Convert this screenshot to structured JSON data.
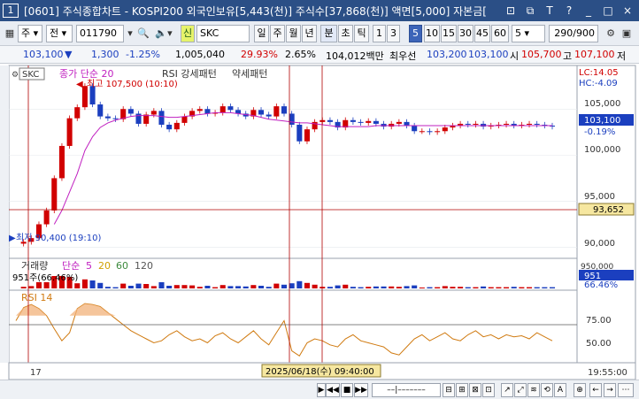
{
  "window": {
    "number": "1",
    "title": "[0601] 주식종합차트 - KOSPI200 외국인보유[5,443(천)] 주식수[37,868(천)] 액면[5,000] 자본금[",
    "buttons": [
      "⊡",
      "⧉",
      "T",
      "?",
      "_",
      "□",
      "×"
    ]
  },
  "toolbar": {
    "market": "주",
    "type": "전",
    "code": "011790",
    "name": "SKC",
    "badge": "신",
    "periods": [
      "일",
      "주",
      "월",
      "년",
      "분",
      "초",
      "틱"
    ],
    "active_period": "분",
    "intervals": [
      "1",
      "3",
      "5",
      "10",
      "15",
      "30",
      "45",
      "60"
    ],
    "active_interval": "5",
    "count": "5",
    "range": "290/900"
  },
  "quote": {
    "price": "103,100",
    "change": "1,300",
    "change_pct": "-1.25%",
    "volume": "1,005,040",
    "turnover_pct": "29.93%",
    "vol_pct": "2.65%",
    "amount": "104,012백만",
    "label_best_ask": "최우선",
    "best_ask": "103,200",
    "best_bid": "103,100",
    "label_open": "시",
    "open": "105,700",
    "label_high": "고",
    "high": "107,100",
    "label_low": "저"
  },
  "chart": {
    "legend_symbol": "SKC",
    "legend_ma": "종가 단순 20",
    "legend_rsi_pattern": "RSI 강세패턴",
    "legend_weak": "약세패턴",
    "high_label": "최고 107,500 (10:10)",
    "low_label": "최저 90,400 (19:10)",
    "lc": "LC:14.05",
    "hc": "HC:-4.09",
    "current_price": "103,100",
    "current_pct": "-0.19%",
    "crosshair_price": "93,652",
    "price_axis": [
      "105,000",
      "100,000",
      "95,000",
      "90,000"
    ],
    "volume_legend_title": "거래량",
    "volume_legend_ma": "단순",
    "volume_legend_periods": [
      "5",
      "20",
      "60",
      "120"
    ],
    "volume_value": "951주(66.46%)",
    "volume_axis_top": "950,000",
    "volume_current": "951",
    "volume_pct": "66.46%",
    "rsi_title": "RSI 14",
    "rsi_axis": [
      "75.00",
      "50.00"
    ],
    "time_start": "17",
    "time_cursor": "2025/06/18(수) 09:40:00",
    "time_end": "19:55:00"
  },
  "colors": {
    "up": "#d10000",
    "down": "#1b3fbf",
    "ma": "#c020c0",
    "rsi": "#d07a10",
    "crosshair": "#b00000"
  },
  "chart_data": {
    "type": "candlestick",
    "price_series": [
      90400,
      90600,
      91000,
      92500,
      94000,
      97500,
      101000,
      104000,
      105200,
      107500,
      105500,
      104200,
      104000,
      103900,
      105000,
      104500,
      103400,
      104400,
      104800,
      103300,
      102800,
      103500,
      104200,
      104800,
      105000,
      104500,
      104600,
      105300,
      104900,
      104500,
      104200,
      104900,
      104400,
      104200,
      105300,
      104500,
      103300,
      101500,
      102800,
      103600,
      103800,
      103600,
      103000,
      103800,
      103600,
      103500,
      103700,
      103400,
      103100,
      103400,
      103600,
      103200,
      102600,
      102600,
      102500,
      102600,
      103000,
      103200,
      103400,
      103300,
      103400,
      103100,
      103200,
      103300,
      103400,
      103200,
      103300,
      103400,
      103300,
      103200,
      103100
    ],
    "ma20_series": [
      null,
      null,
      null,
      null,
      null,
      92500,
      94000,
      96000,
      98000,
      100500,
      102000,
      103000,
      103500,
      103800,
      104000,
      104200,
      104300,
      104300,
      104300,
      104200,
      104100,
      104100,
      104200,
      104300,
      104400,
      104500,
      104600,
      104600,
      104600,
      104500,
      104400,
      104300,
      104100,
      103900,
      103800,
      103700,
      103600,
      103500,
      103500,
      103400,
      103300,
      103200,
      103100,
      103100,
      103100,
      103100,
      103100,
      103200,
      103200,
      103200,
      103200,
      103200,
      103200,
      103200,
      103200,
      103200,
      103200,
      103200,
      103200,
      103200,
      103200,
      103200,
      103200,
      103200,
      103200,
      103200,
      103200,
      103200,
      103200,
      103200,
      103200
    ],
    "rsi_series": [
      70,
      83,
      86,
      82,
      75,
      62,
      50,
      58,
      82,
      87,
      86,
      84,
      78,
      72,
      66,
      60,
      56,
      52,
      48,
      50,
      56,
      60,
      54,
      50,
      52,
      48,
      55,
      58,
      52,
      48,
      54,
      60,
      52,
      46,
      58,
      70,
      40,
      35,
      48,
      52,
      50,
      46,
      44,
      52,
      56,
      50,
      48,
      46,
      44,
      38,
      36,
      44,
      52,
      56,
      50,
      54,
      58,
      52,
      50,
      56,
      60,
      54,
      56,
      52,
      56,
      54,
      55,
      52,
      58,
      54,
      50
    ],
    "ylim_price": [
      89000,
      108000
    ],
    "ylim_rsi": [
      30,
      95
    ],
    "ylabel": ""
  }
}
